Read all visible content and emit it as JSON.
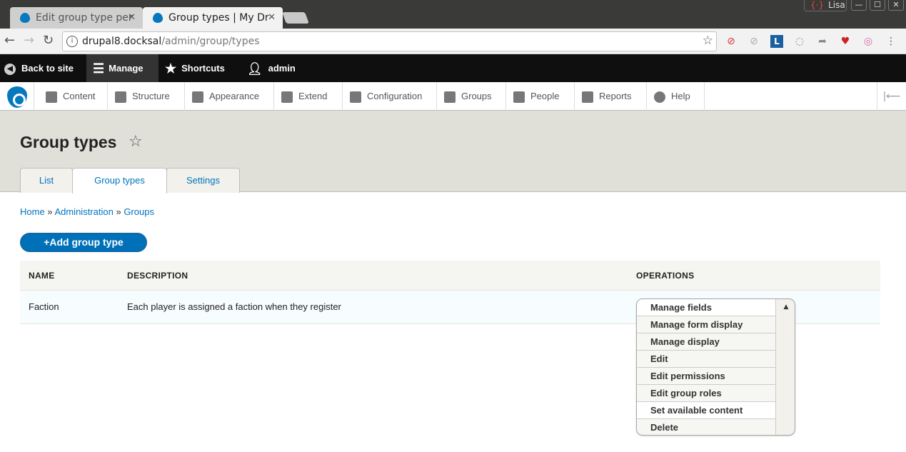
{
  "browser": {
    "tabs": [
      {
        "title": "Edit group type per"
      },
      {
        "title": "Group types | My Dr"
      }
    ],
    "profile_name": "Lisa",
    "url_host": "drupal8.docksal",
    "url_path": "/admin/group/types"
  },
  "admin_toolbar": {
    "back": "Back to site",
    "manage": "Manage",
    "shortcuts": "Shortcuts",
    "user": "admin"
  },
  "tray": {
    "items": [
      "Content",
      "Structure",
      "Appearance",
      "Extend",
      "Configuration",
      "Groups",
      "People",
      "Reports",
      "Help"
    ]
  },
  "page": {
    "title": "Group types",
    "tabs": [
      "List",
      "Group types",
      "Settings"
    ],
    "active_tab": "Group types",
    "breadcrumb": [
      "Home",
      "Administration",
      "Groups"
    ],
    "breadcrumb_sep": "»",
    "add_button": "+Add group type"
  },
  "table": {
    "headers": [
      "NAME",
      "DESCRIPTION",
      "OPERATIONS"
    ],
    "rows": [
      {
        "name": "Faction",
        "description": "Each player is assigned a faction when they register"
      }
    ]
  },
  "operations": [
    "Manage fields",
    "Manage form display",
    "Manage display",
    "Edit",
    "Edit permissions",
    "Edit group roles",
    "Set available content",
    "Delete"
  ]
}
